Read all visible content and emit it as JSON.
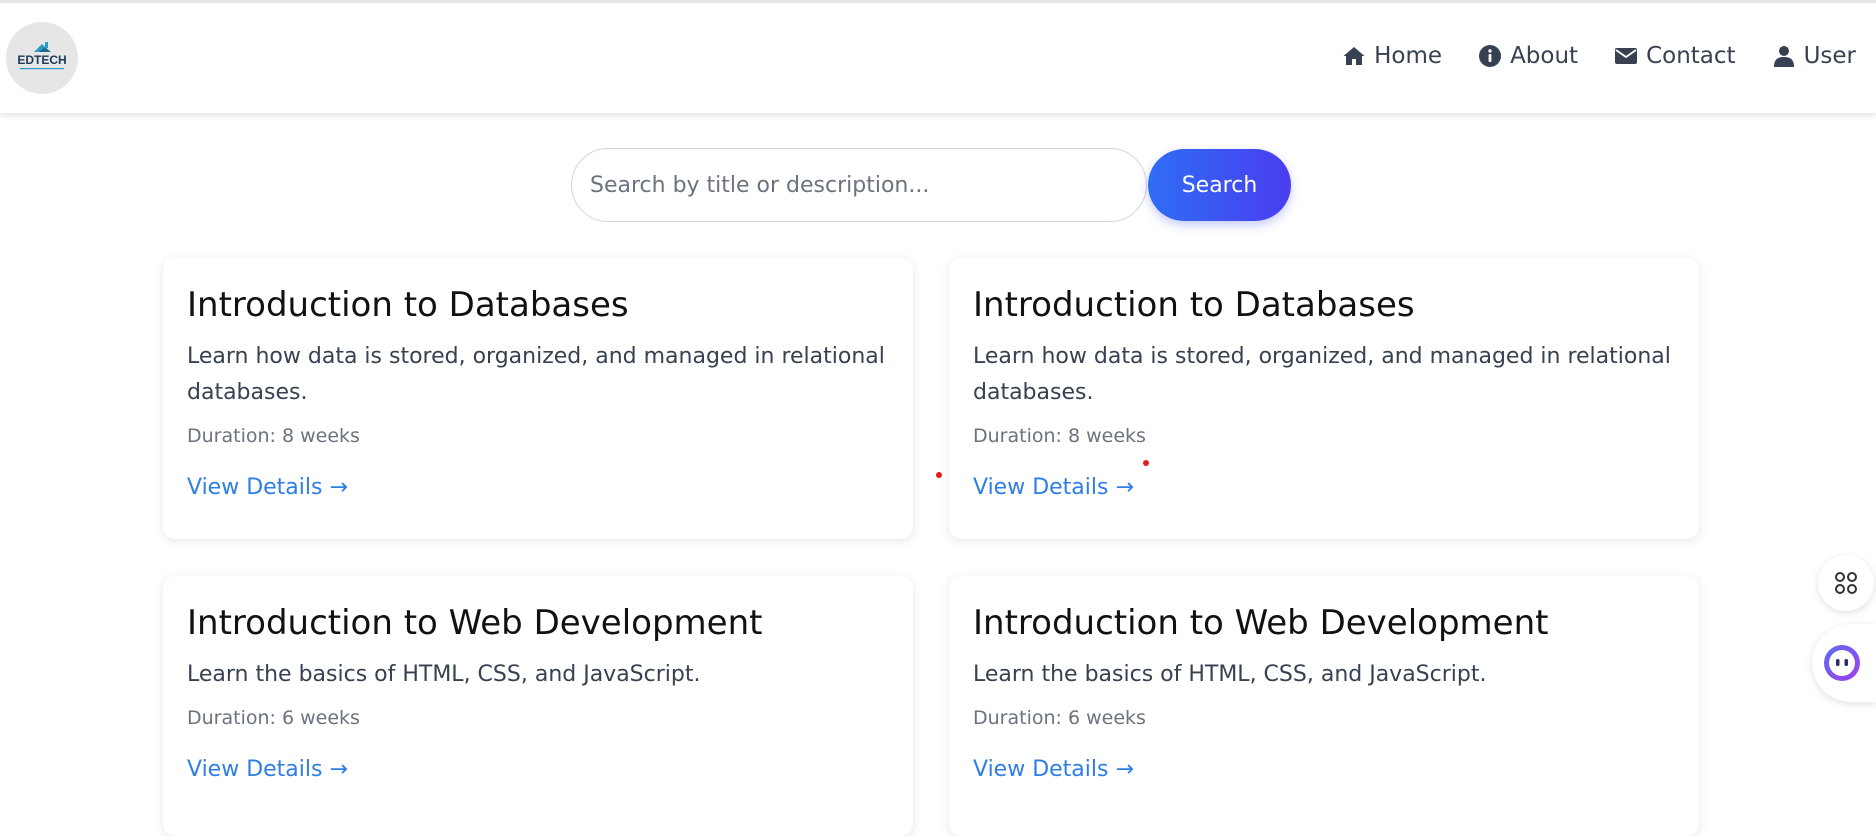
{
  "logo": {
    "text": "EDTECH"
  },
  "nav": {
    "items": [
      {
        "label": "Home",
        "icon": "home-icon"
      },
      {
        "label": "About",
        "icon": "info-icon"
      },
      {
        "label": "Contact",
        "icon": "envelope-icon"
      },
      {
        "label": "User",
        "icon": "user-icon"
      }
    ]
  },
  "search": {
    "placeholder": "Search by title or description...",
    "value": "",
    "button_label": "Search"
  },
  "courses": [
    {
      "title": "Introduction to Databases",
      "description": "Learn how data is stored, organized, and managed in relational databases.",
      "duration": "Duration: 8 weeks",
      "link": "View Details →"
    },
    {
      "title": "Introduction to Databases",
      "description": "Learn how data is stored, organized, and managed in relational databases.",
      "duration": "Duration: 8 weeks",
      "link": "View Details →"
    },
    {
      "title": "Introduction to Web Development",
      "description": "Learn the basics of HTML, CSS, and JavaScript.",
      "duration": "Duration: 6 weeks",
      "link": "View Details →"
    },
    {
      "title": "Introduction to Web Development",
      "description": "Learn the basics of HTML, CSS, and JavaScript.",
      "duration": "Duration: 6 weeks",
      "link": "View Details →"
    }
  ],
  "colors": {
    "accent_link": "#2f7de6",
    "search_gradient_start": "#2f6df5",
    "search_gradient_end": "#4a3df0",
    "nav_text": "#374151"
  },
  "side_widgets": [
    {
      "icon": "apps-grid-icon"
    },
    {
      "icon": "assistant-bot-icon"
    }
  ]
}
